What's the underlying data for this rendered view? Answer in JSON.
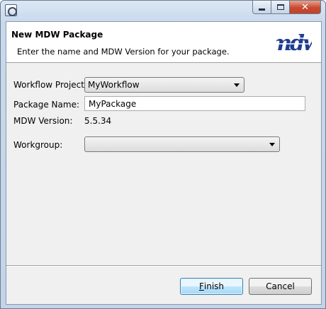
{
  "window": {
    "title": ""
  },
  "header": {
    "title": "New MDW Package",
    "description": "Enter the name and MDW Version for your package.",
    "logo_text": "mdw"
  },
  "form": {
    "workflow_project": {
      "label": "Workflow Project:",
      "value": "MyWorkflow"
    },
    "package_name": {
      "label": "Package Name:",
      "value": "MyPackage"
    },
    "mdw_version": {
      "label": "MDW Version:",
      "value": "5.5.34"
    },
    "workgroup": {
      "label": "Workgroup:",
      "value": ""
    }
  },
  "buttons": {
    "finish_mnemonic": "F",
    "finish_rest": "inish",
    "cancel": "Cancel"
  },
  "colors": {
    "logo_blue": "#1f3c8f",
    "default_button_border": "#3c7fb1",
    "close_button": "#c74a31"
  }
}
